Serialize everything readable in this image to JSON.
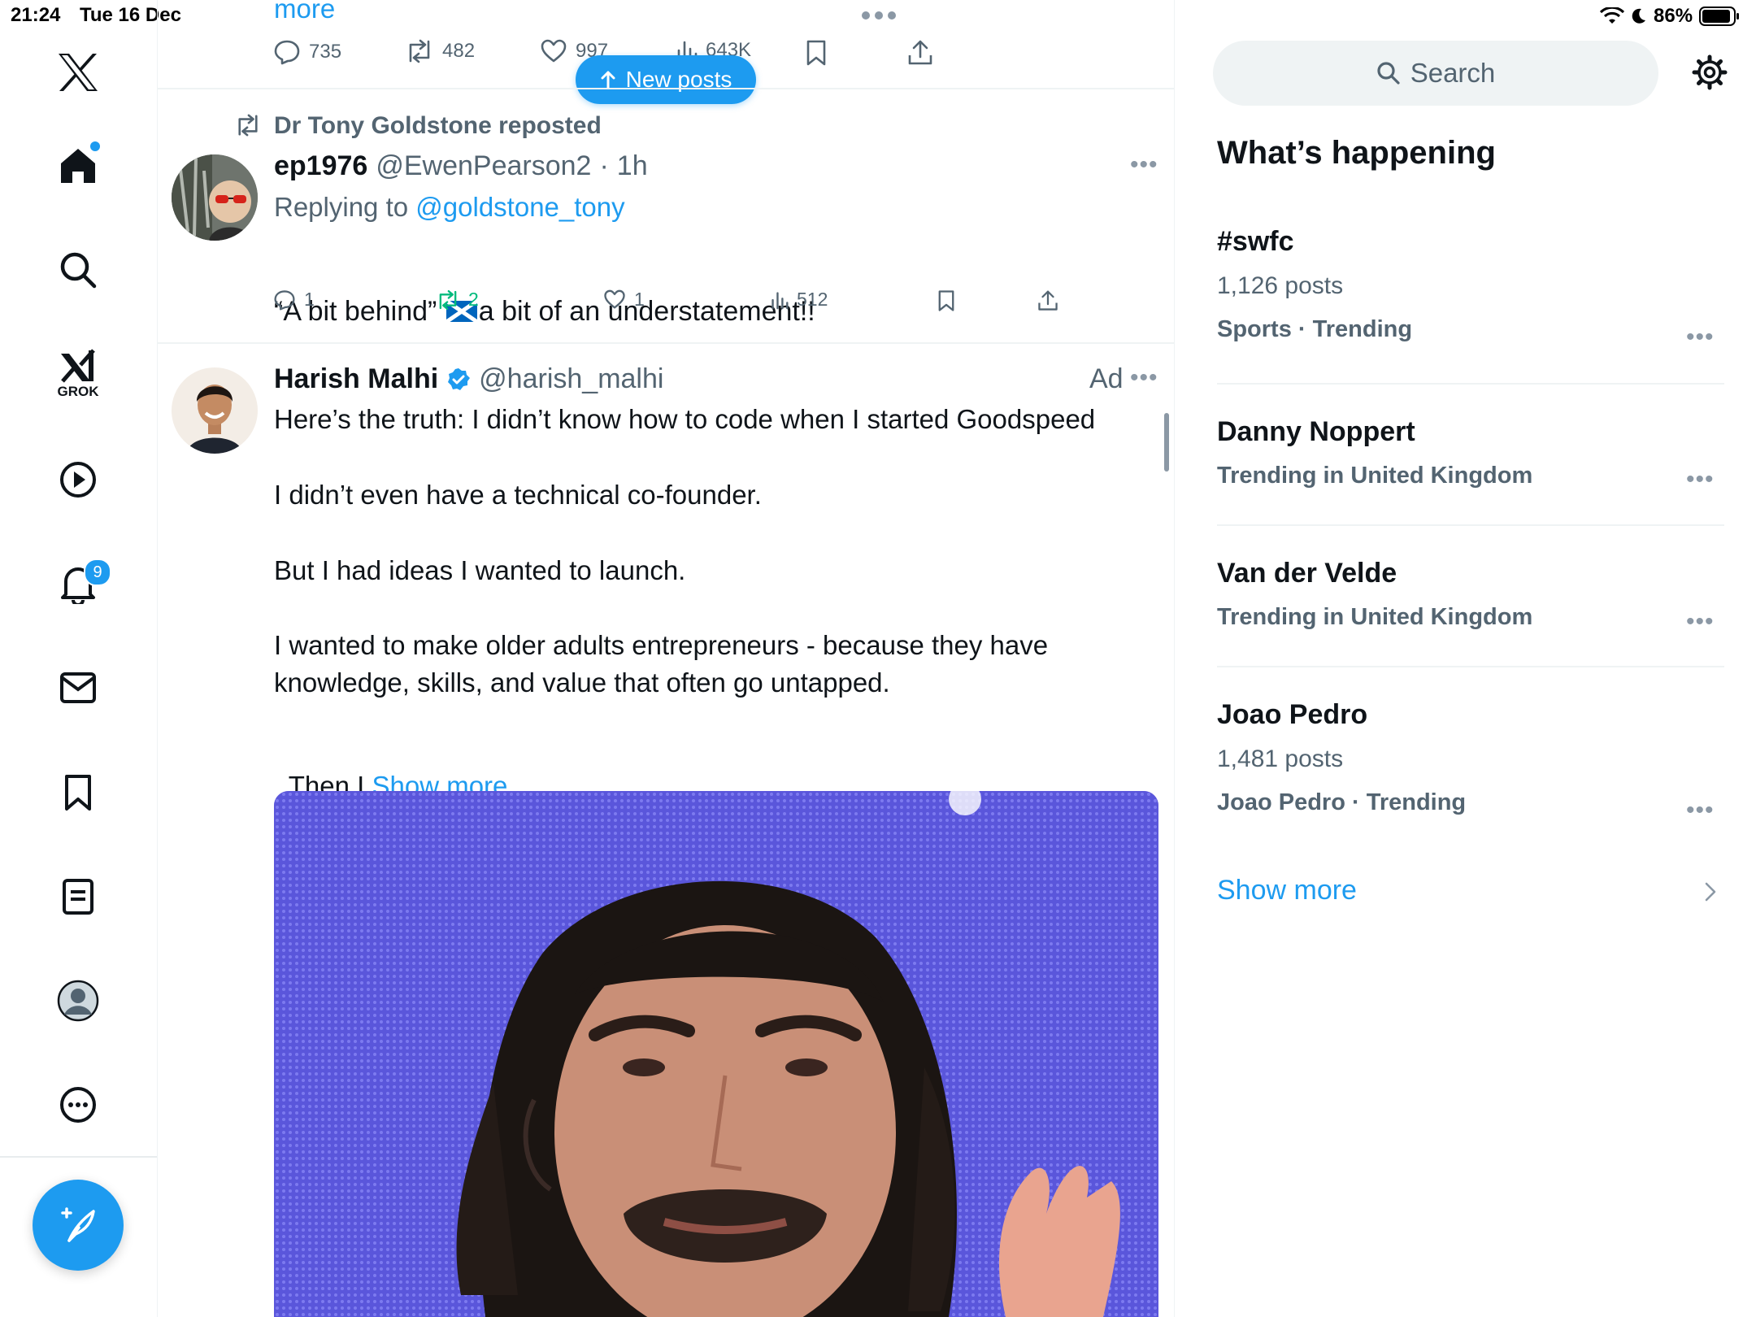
{
  "status_bar": {
    "time": "21:24",
    "date": "Tue 16 Dec",
    "battery": "86%"
  },
  "nav": {
    "items": [
      "logo",
      "home",
      "explore",
      "grok",
      "video",
      "notifications",
      "messages",
      "bookmarks",
      "lists",
      "profile",
      "more"
    ],
    "grok_label": "GROK",
    "notifications_badge": "9"
  },
  "feed": {
    "prev_tweet": {
      "more_text": "more",
      "replies": "735",
      "reposts": "482",
      "likes": "997",
      "views": "643K"
    },
    "new_posts_label": "New posts",
    "reply_tweet": {
      "repost_context": "Dr Tony Goldstone reposted",
      "display_name": "ep1976",
      "handle": "@EwenPearson2",
      "time": "1h",
      "replying_to_label": "Replying to",
      "replying_to_handle": "@goldstone_tony",
      "text_before_flag": "“A bit behind” ",
      "text_after_flag": "a bit of an understatement!!",
      "replies": "1",
      "reposts": "2",
      "likes": "1",
      "views": "512"
    },
    "ad_tweet": {
      "display_name": "Harish Malhi",
      "handle": "@harish_malhi",
      "ad_label": "Ad",
      "p1": "Here’s the truth: I didn’t know how to code when I started Goodspeed",
      "p2": "I didn’t even have a technical co-founder.",
      "p3": "But I had ideas I wanted to launch.",
      "p4": "I wanted to make older adults entrepreneurs - because they have knowledge, skills, and value that often go untapped.",
      "p5": "Then I ",
      "show_more": "Show more"
    }
  },
  "sidebar": {
    "search_placeholder": "Search",
    "heading": "What’s happening",
    "trends": [
      {
        "title": "#swfc",
        "posts": "1,126 posts",
        "category": "Sports · Trending"
      },
      {
        "title": "Danny Noppert",
        "posts": "",
        "category": "Trending in United Kingdom"
      },
      {
        "title": "Van der Velde",
        "posts": "",
        "category": "Trending in United Kingdom"
      },
      {
        "title": "Joao Pedro",
        "posts": "1,481 posts",
        "category": "Joao Pedro · Trending"
      }
    ],
    "show_more": "Show more"
  },
  "colors": {
    "accent": "#1d9bf0",
    "repost_green": "#00ba7c",
    "text": "#0f1419",
    "muted": "#536471"
  }
}
